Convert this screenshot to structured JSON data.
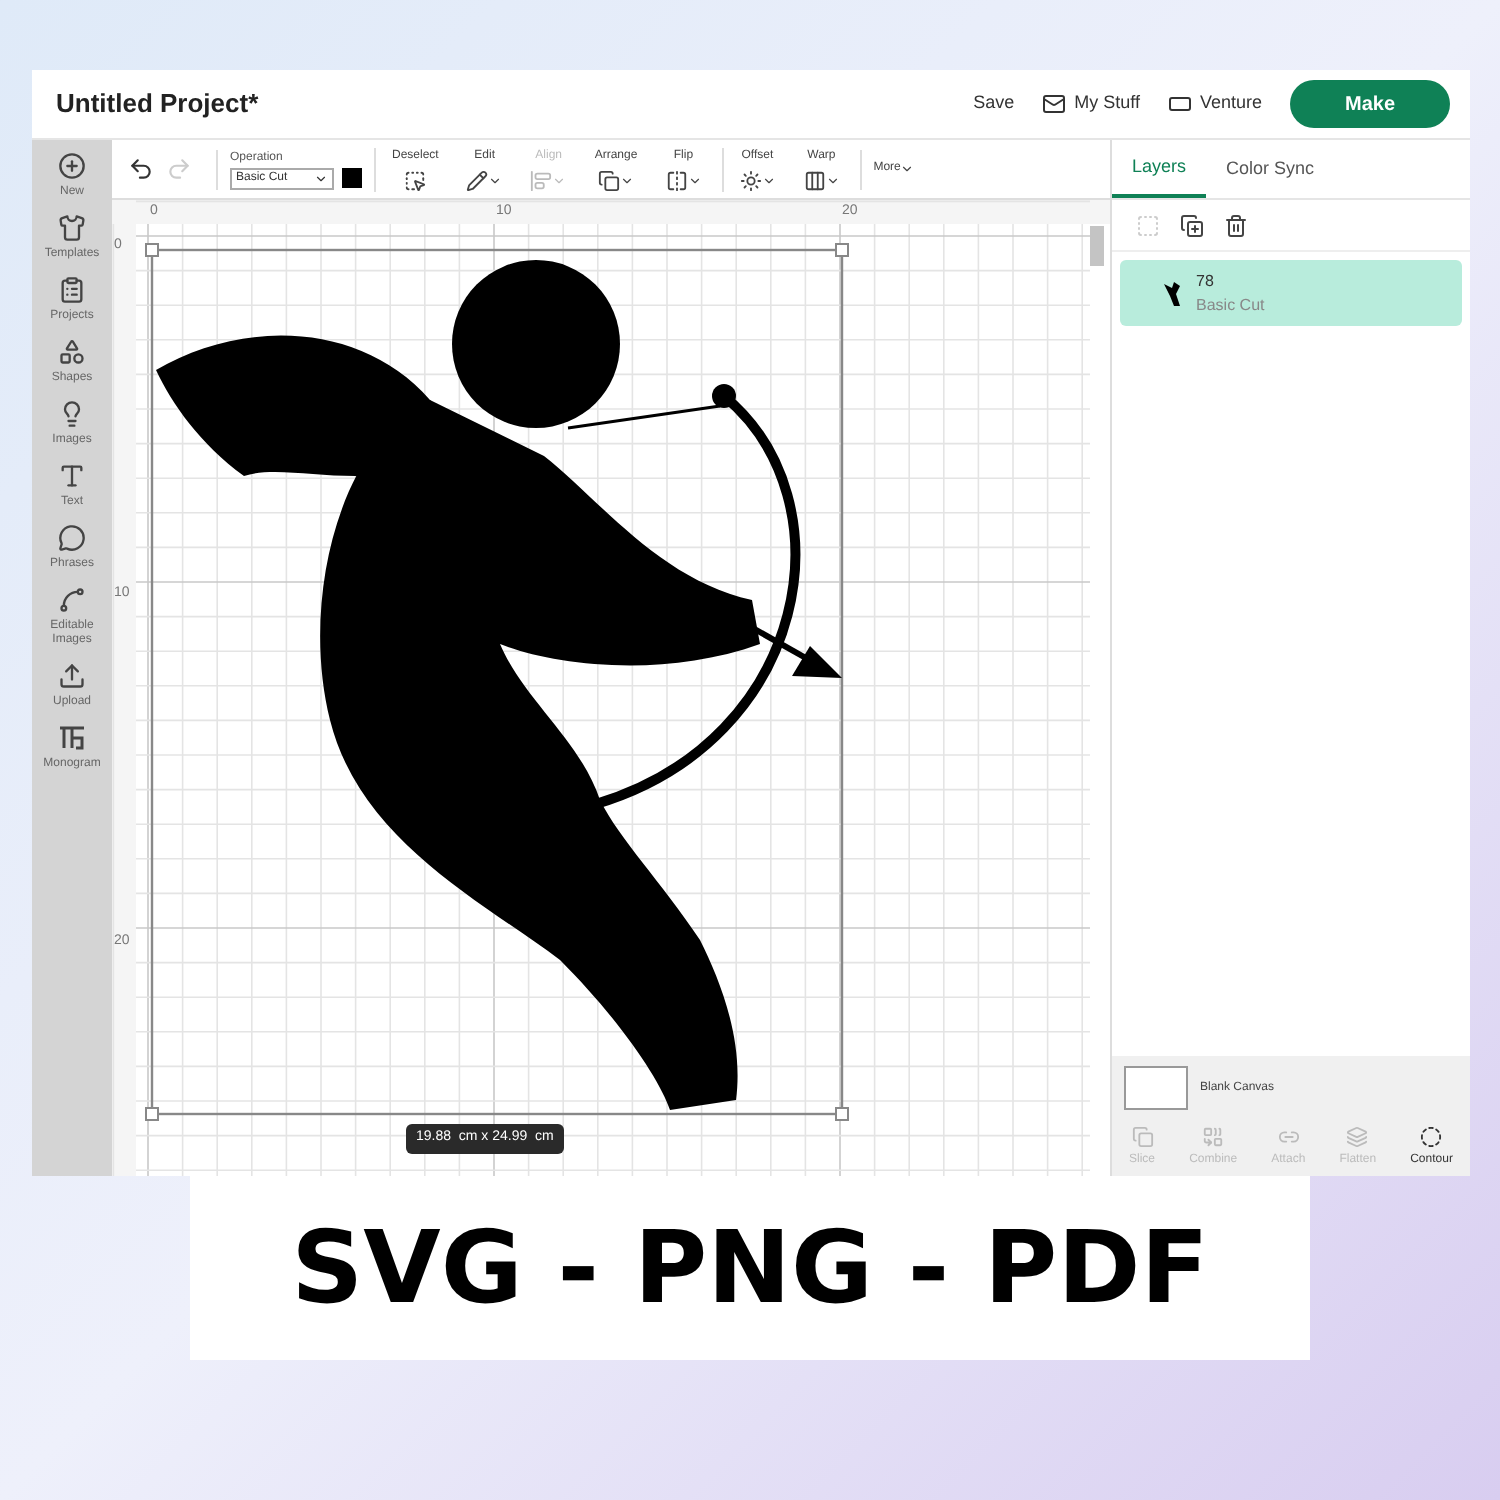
{
  "header": {
    "title": "Untitled Project*",
    "actions": [
      {
        "label": "Save"
      },
      {
        "label": "My Stuff"
      },
      {
        "label": "Venture"
      }
    ],
    "make": "Make"
  },
  "sidebar": {
    "items": [
      {
        "label": "New"
      },
      {
        "label": "Templates"
      },
      {
        "label": "Projects"
      },
      {
        "label": "Shapes"
      },
      {
        "label": "Images"
      },
      {
        "label": "Text"
      },
      {
        "label": "Phrases"
      },
      {
        "label": "Editable Images"
      },
      {
        "label": "Upload"
      },
      {
        "label": "Monogram"
      }
    ]
  },
  "toolbar": {
    "undo_disabled": false,
    "redo_disabled": true,
    "operation": {
      "label": "Operation",
      "value": "Basic Cut",
      "color": "#000000"
    },
    "tools": [
      {
        "label": "Deselect",
        "disabled": false,
        "menu": false
      },
      {
        "label": "Edit",
        "disabled": false,
        "menu": true
      },
      {
        "label": "Align",
        "disabled": true,
        "menu": true
      },
      {
        "label": "Arrange",
        "disabled": false,
        "menu": true
      },
      {
        "label": "Flip",
        "disabled": false,
        "menu": true
      },
      {
        "label": "Offset",
        "disabled": false,
        "menu": true
      },
      {
        "label": "Warp",
        "disabled": false,
        "menu": true
      }
    ],
    "more": "More"
  },
  "canvas": {
    "x_ruler": [
      "0",
      "10",
      "20"
    ],
    "y_ruler": [
      "0",
      "10",
      "20"
    ],
    "size_label": "19.88  cm x 24.99  cm"
  },
  "panel": {
    "tabs": [
      {
        "label": "Layers",
        "selected": true
      },
      {
        "label": "Color Sync",
        "selected": false
      }
    ],
    "actions": [
      {
        "disabled": true
      },
      {
        "disabled": false
      },
      {
        "disabled": false
      }
    ],
    "layers": [
      {
        "name": "78",
        "operation": "Basic Cut",
        "selected": true
      }
    ],
    "blank_canvas": "Blank Canvas",
    "tools": [
      {
        "label": "Slice",
        "disabled": true
      },
      {
        "label": "Combine",
        "disabled": true
      },
      {
        "label": "Attach",
        "disabled": true
      },
      {
        "label": "Flatten",
        "disabled": true
      },
      {
        "label": "Contour",
        "disabled": false
      }
    ]
  },
  "banner": {
    "text": "SVG - PNG - PDF"
  }
}
